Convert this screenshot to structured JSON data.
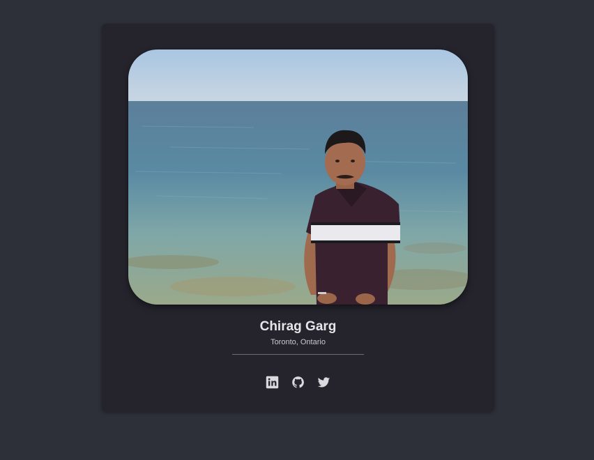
{
  "profile": {
    "name": "Chirag Garg",
    "location": "Toronto, Ontario"
  },
  "socials": [
    {
      "icon": "linkedin-icon",
      "label": "LinkedIn"
    },
    {
      "icon": "github-icon",
      "label": "GitHub"
    },
    {
      "icon": "twitter-icon",
      "label": "Twitter"
    }
  ],
  "colors": {
    "page_background": "#2e3039",
    "card_background": "#25242d",
    "text_primary": "#e6e6ea",
    "icon": "#d9d9de"
  }
}
